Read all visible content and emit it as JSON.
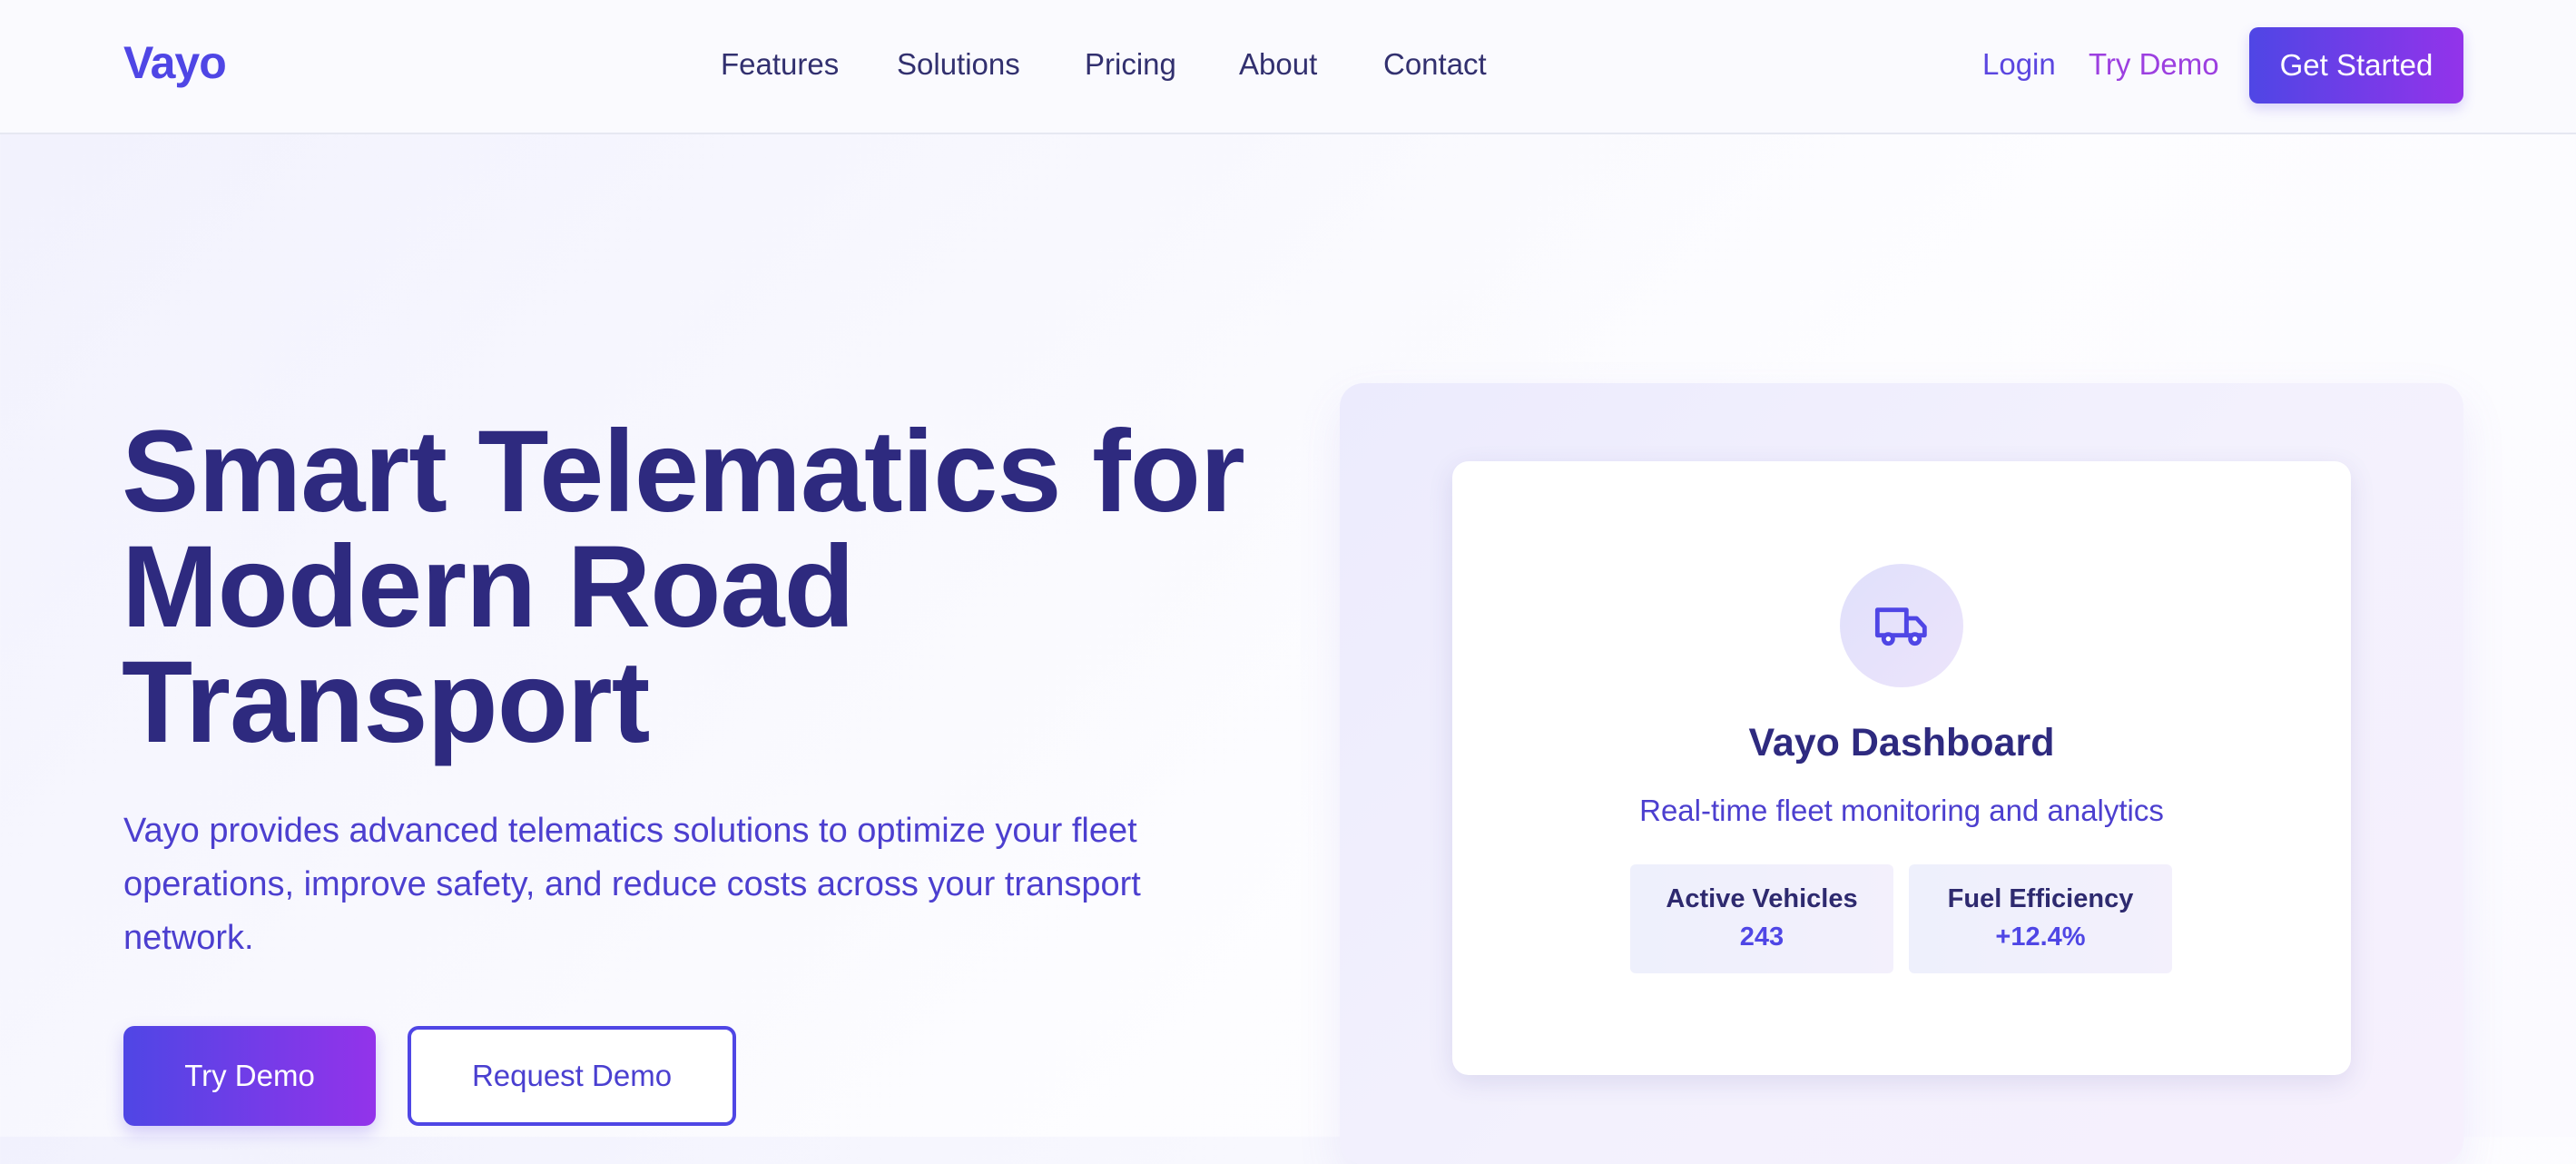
{
  "brand": {
    "name": "Vayo"
  },
  "nav": {
    "links": [
      "Features",
      "Solutions",
      "Pricing",
      "About",
      "Contact"
    ],
    "login": "Login",
    "try_demo": "Try Demo",
    "get_started": "Get Started"
  },
  "hero": {
    "title": "Smart Telematics for Modern Road Transport",
    "description": "Vayo provides advanced telematics solutions to optimize your fleet operations, improve safety, and reduce costs across your transport network.",
    "primary_button": "Try Demo",
    "secondary_button": "Request Demo"
  },
  "dashboard": {
    "icon": "truck-icon",
    "title": "Vayo Dashboard",
    "subtitle": "Real-time fleet monitoring and analytics",
    "stats": [
      {
        "label": "Active Vehicles",
        "value": "243"
      },
      {
        "label": "Fuel Efficiency",
        "value": "+12.4%"
      }
    ]
  },
  "colors": {
    "brand": "#4f46e5",
    "accent_purple": "#9333ea",
    "heading": "#2e2a7f",
    "body_text": "#4c3fcf"
  }
}
